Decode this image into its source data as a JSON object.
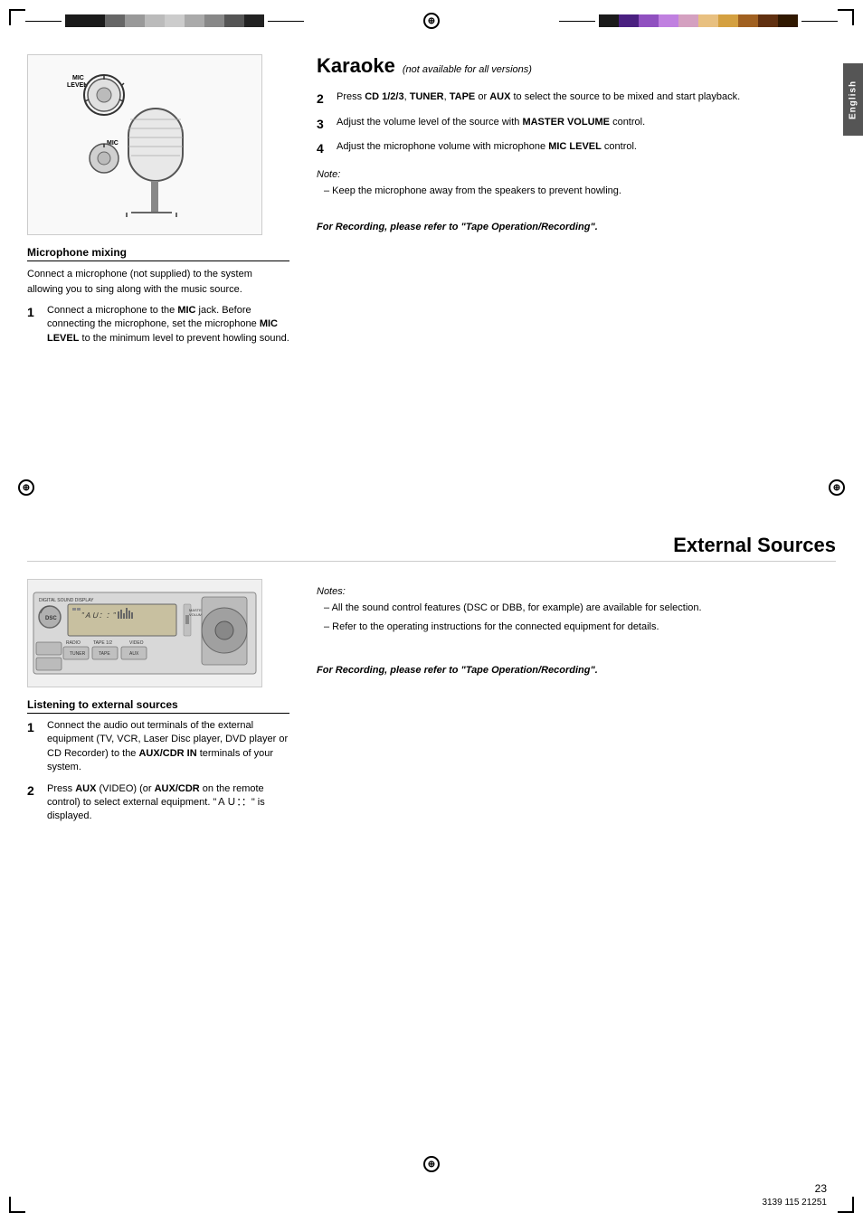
{
  "page": {
    "number": "23",
    "doc_number": "3139 115 21251"
  },
  "top_bars": {
    "left": {
      "colors": [
        "#1a1a1a",
        "#1a1a1a",
        "#888",
        "#aaa",
        "#ccc",
        "#ddd",
        "#aaa",
        "#888",
        "#555",
        "#222"
      ]
    },
    "right": {
      "colors": [
        "#1a1a1a",
        "#4a2080",
        "#9050c0",
        "#c080e0",
        "#d4a0c0",
        "#e8c080",
        "#d4a040",
        "#a06020",
        "#603010",
        "#301800"
      ]
    }
  },
  "karaoke_section": {
    "title": "Karaoke",
    "subtitle": "(not available for all versions)",
    "steps": [
      {
        "num": "2",
        "text": "Press ",
        "bold_parts": [
          "CD 1/2/3",
          ", ",
          "TUNER",
          ", ",
          "TAPE",
          " or ",
          "AUX"
        ],
        "tail": " to select the source to be mixed and start playback."
      },
      {
        "num": "3",
        "text": "Adjust the volume level of the source with ",
        "bold_parts": [
          "MASTER VOLUME"
        ],
        "tail": " control."
      },
      {
        "num": "4",
        "text": "Adjust the microphone volume with microphone ",
        "bold_parts": [
          "MIC LEVEL"
        ],
        "tail": " control."
      }
    ],
    "note_label": "Note:",
    "note_dash": "– Keep the microphone away from the speakers to prevent howling.",
    "recording_ref": "For Recording, please refer to \"Tape Operation/Recording\"."
  },
  "microphone_section": {
    "heading": "Microphone mixing",
    "intro": "Connect a microphone (not supplied) to the system allowing you to sing along with the music source.",
    "steps": [
      {
        "num": "1",
        "text": "Connect a microphone to the ",
        "bold": "MIC",
        "tail": " jack. Before connecting the microphone, set the microphone ",
        "bold2": "MIC LEVEL",
        "tail2": " to the minimum level to prevent howling sound."
      }
    ]
  },
  "external_section": {
    "title": "External Sources",
    "notes_label": "Notes:",
    "notes": [
      "– All the sound control features (DSC or DBB, for example) are available for selection.",
      "– Refer to the operating instructions for the connected equipment for details."
    ],
    "recording_ref": "For Recording, please refer to \"Tape Operation/Recording\"."
  },
  "listening_section": {
    "heading": "Listening to external sources",
    "steps": [
      {
        "num": "1",
        "text": "Connect the audio out terminals of the external equipment (TV, VCR, Laser Disc player, DVD player or CD Recorder) to the ",
        "bold": "AUX/CDR IN",
        "tail": " terminals of your system."
      },
      {
        "num": "2",
        "text": "Press ",
        "bold": "AUX",
        "tail": " (VIDEO) (or ",
        "bold2": "AUX/CDR",
        "tail2": " on the remote control) to select external equipment. \"ＡＵ：：\" is displayed."
      }
    ]
  },
  "sidebar": {
    "label": "English"
  },
  "mic_labels": {
    "mic_level": "MIC\nLEVEL",
    "mic": "MIC"
  },
  "display_labels": {
    "dsc": "DSC",
    "radio": "RADIO",
    "tape": "TAPE 1/2",
    "video": "VIDEO",
    "tuner": "TUNER",
    "tape2": "TAPE",
    "aux": "AUX",
    "master_vol": "MASTE\nVOLUM"
  }
}
